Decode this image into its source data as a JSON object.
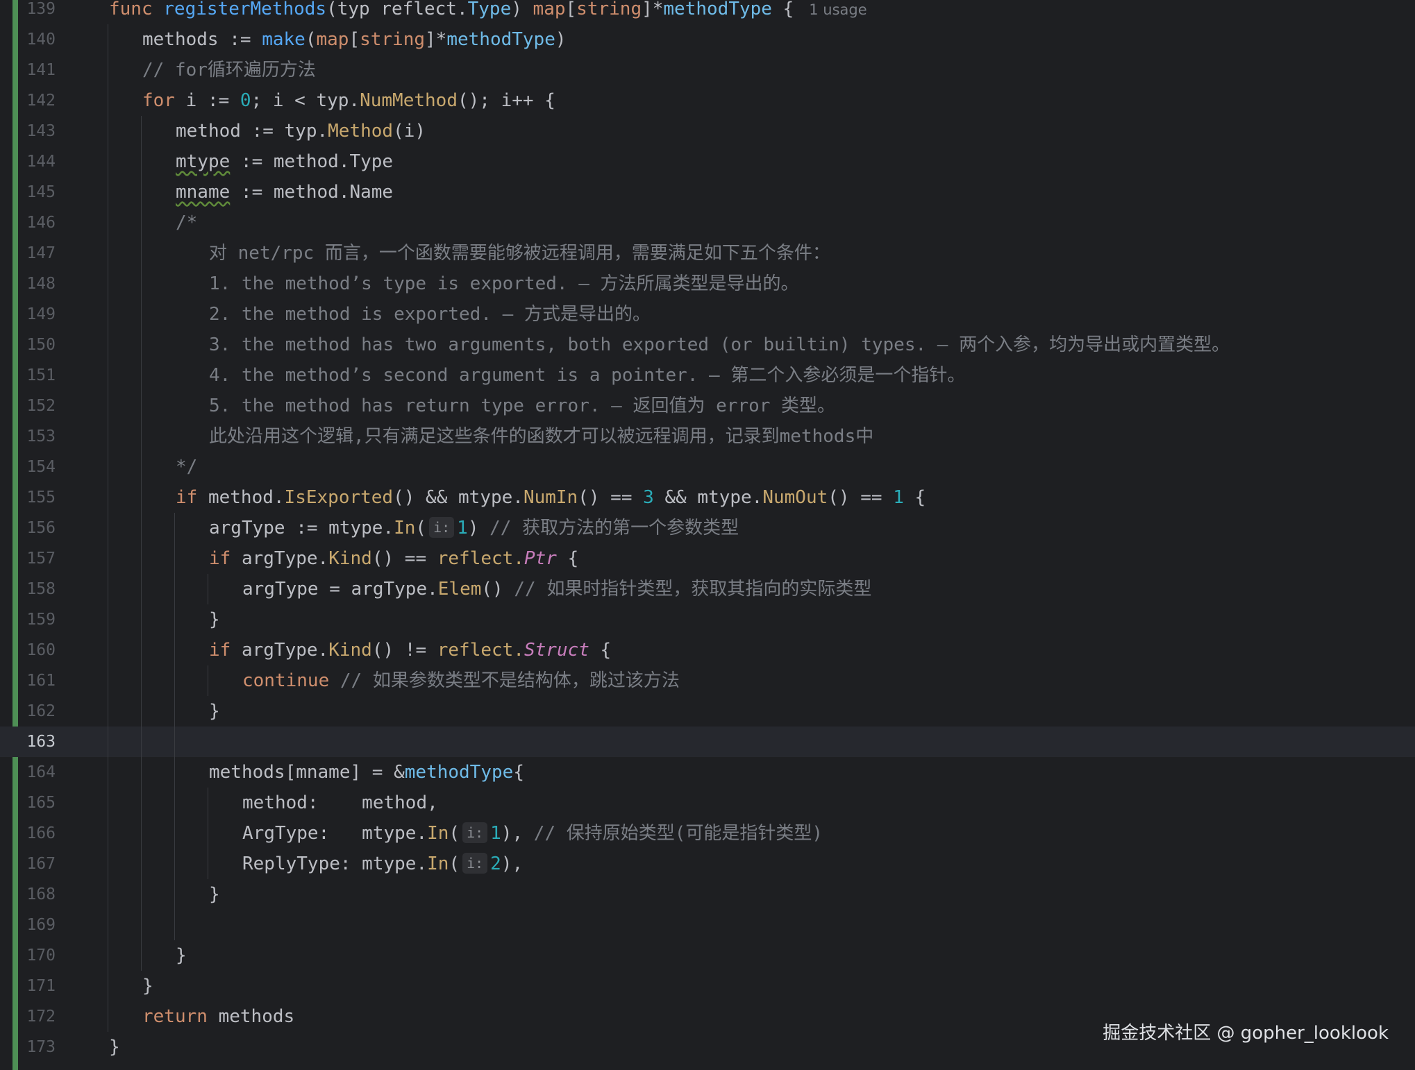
{
  "editor": {
    "current_line": "163",
    "line_numbers": [
      "139",
      "140",
      "141",
      "142",
      "143",
      "144",
      "145",
      "146",
      "147",
      "148",
      "149",
      "150",
      "151",
      "152",
      "153",
      "154",
      "155",
      "156",
      "157",
      "158",
      "159",
      "160",
      "161",
      "162",
      "163",
      "164",
      "165",
      "166",
      "167",
      "168",
      "169",
      "170",
      "171",
      "172",
      "173"
    ],
    "inlay_hint": "i:",
    "usage_hint": "1 usage",
    "colors": {
      "background": "#1e1f22",
      "keyword": "#cf8e6d",
      "function": "#56a8f5",
      "number": "#2aacb8",
      "comment": "#7a7e85",
      "constant": "#c77dbb",
      "vcs_modified_bar": "#4e8f55"
    },
    "code": {
      "l139": {
        "kw": "func",
        "name": "registerMethods",
        "params": "(typ ",
        "pkg": "reflect.",
        "ptype": "Type",
        "close": ") ",
        "map": "map",
        "lb": "[",
        "str": "string",
        "rb": "]*",
        "ret": "methodType",
        "brace": " {"
      },
      "l140": {
        "a": "methods := ",
        "make": "make",
        "lp": "(",
        "map": "map",
        "lb": "[",
        "str": "string",
        "rb": "]*",
        "t": "methodType",
        "rp": ")"
      },
      "l141": {
        "cmt": "// for循环遍历方法"
      },
      "l142": {
        "kw": "for",
        "a": " i := ",
        "zero": "0",
        "b": "; i < typ.",
        "m": "NumMethod",
        "c": "(); i++ {"
      },
      "l143": {
        "a": "method := typ.",
        "m": "Method",
        "b": "(i)"
      },
      "l144": {
        "v": "mtype",
        "b": " := method.Type"
      },
      "l145": {
        "v": "mname",
        "b": " := method.Name"
      },
      "l146": {
        "cmt": "/*"
      },
      "l147": {
        "cmt": "对 net/rpc 而言，一个函数需要能够被远程调用，需要满足如下五个条件："
      },
      "l148": {
        "cmt": "1. the method’s type is exported. – 方法所属类型是导出的。"
      },
      "l149": {
        "cmt": "2. the method is exported. – 方式是导出的。"
      },
      "l150": {
        "cmt": "3. the method has two arguments, both exported (or builtin) types. – 两个入参，均为导出或内置类型。"
      },
      "l151": {
        "cmt": "4. the method’s second argument is a pointer. – 第二个入参必须是一个指针。"
      },
      "l152": {
        "cmt": "5. the method has return type error. – 返回值为 error 类型。"
      },
      "l153": {
        "cmt": "此处沿用这个逻辑,只有满足这些条件的函数才可以被远程调用，记录到methods中"
      },
      "l154": {
        "cmt": "*/"
      },
      "l155": {
        "kw": "if",
        "a": " method.",
        "m1": "IsExported",
        "b": "() && mtype.",
        "m2": "NumIn",
        "c": "() == ",
        "n1": "3",
        "d": " && mtype.",
        "m3": "NumOut",
        "e": "() == ",
        "n2": "1",
        "f": " {"
      },
      "l156": {
        "a": "argType := mtype.",
        "m": "In",
        "lp": "(",
        "n": "1",
        "rp": ") ",
        "cmt": "// 获取方法的第一个参数类型"
      },
      "l157": {
        "kw": "if",
        "a": " argType.",
        "m": "Kind",
        "b": "() == ",
        "pkg": "reflect.",
        "c": "Ptr",
        "d": " {"
      },
      "l158": {
        "a": "argType = argType.",
        "m": "Elem",
        "b": "() ",
        "cmt": "// 如果时指针类型，获取其指向的实际类型"
      },
      "l159": {
        "a": "}"
      },
      "l160": {
        "kw": "if",
        "a": " argType.",
        "m": "Kind",
        "b": "() != ",
        "pkg": "reflect.",
        "c": "Struct",
        "d": " {"
      },
      "l161": {
        "kw": "continue",
        "sp": " ",
        "cmt": "// 如果参数类型不是结构体，跳过该方法"
      },
      "l162": {
        "a": "}"
      },
      "l164": {
        "a": "methods[mname] = &",
        "t": "methodType",
        "b": "{"
      },
      "l165": {
        "a": "method:    method,"
      },
      "l166": {
        "a": "ArgType:   mtype.",
        "m": "In",
        "lp": "(",
        "n": "1",
        "rp": "), ",
        "cmt": "// 保持原始类型(可能是指针类型)"
      },
      "l167": {
        "a": "ReplyType: mtype.",
        "m": "In",
        "lp": "(",
        "n": "2",
        "rp": "),"
      },
      "l168": {
        "a": "}"
      },
      "l170": {
        "a": "}"
      },
      "l171": {
        "a": "}"
      },
      "l172": {
        "kw": "return",
        "a": " methods"
      },
      "l173": {
        "a": "}"
      }
    }
  },
  "watermark": "掘金技术社区 @ gopher_looklook"
}
